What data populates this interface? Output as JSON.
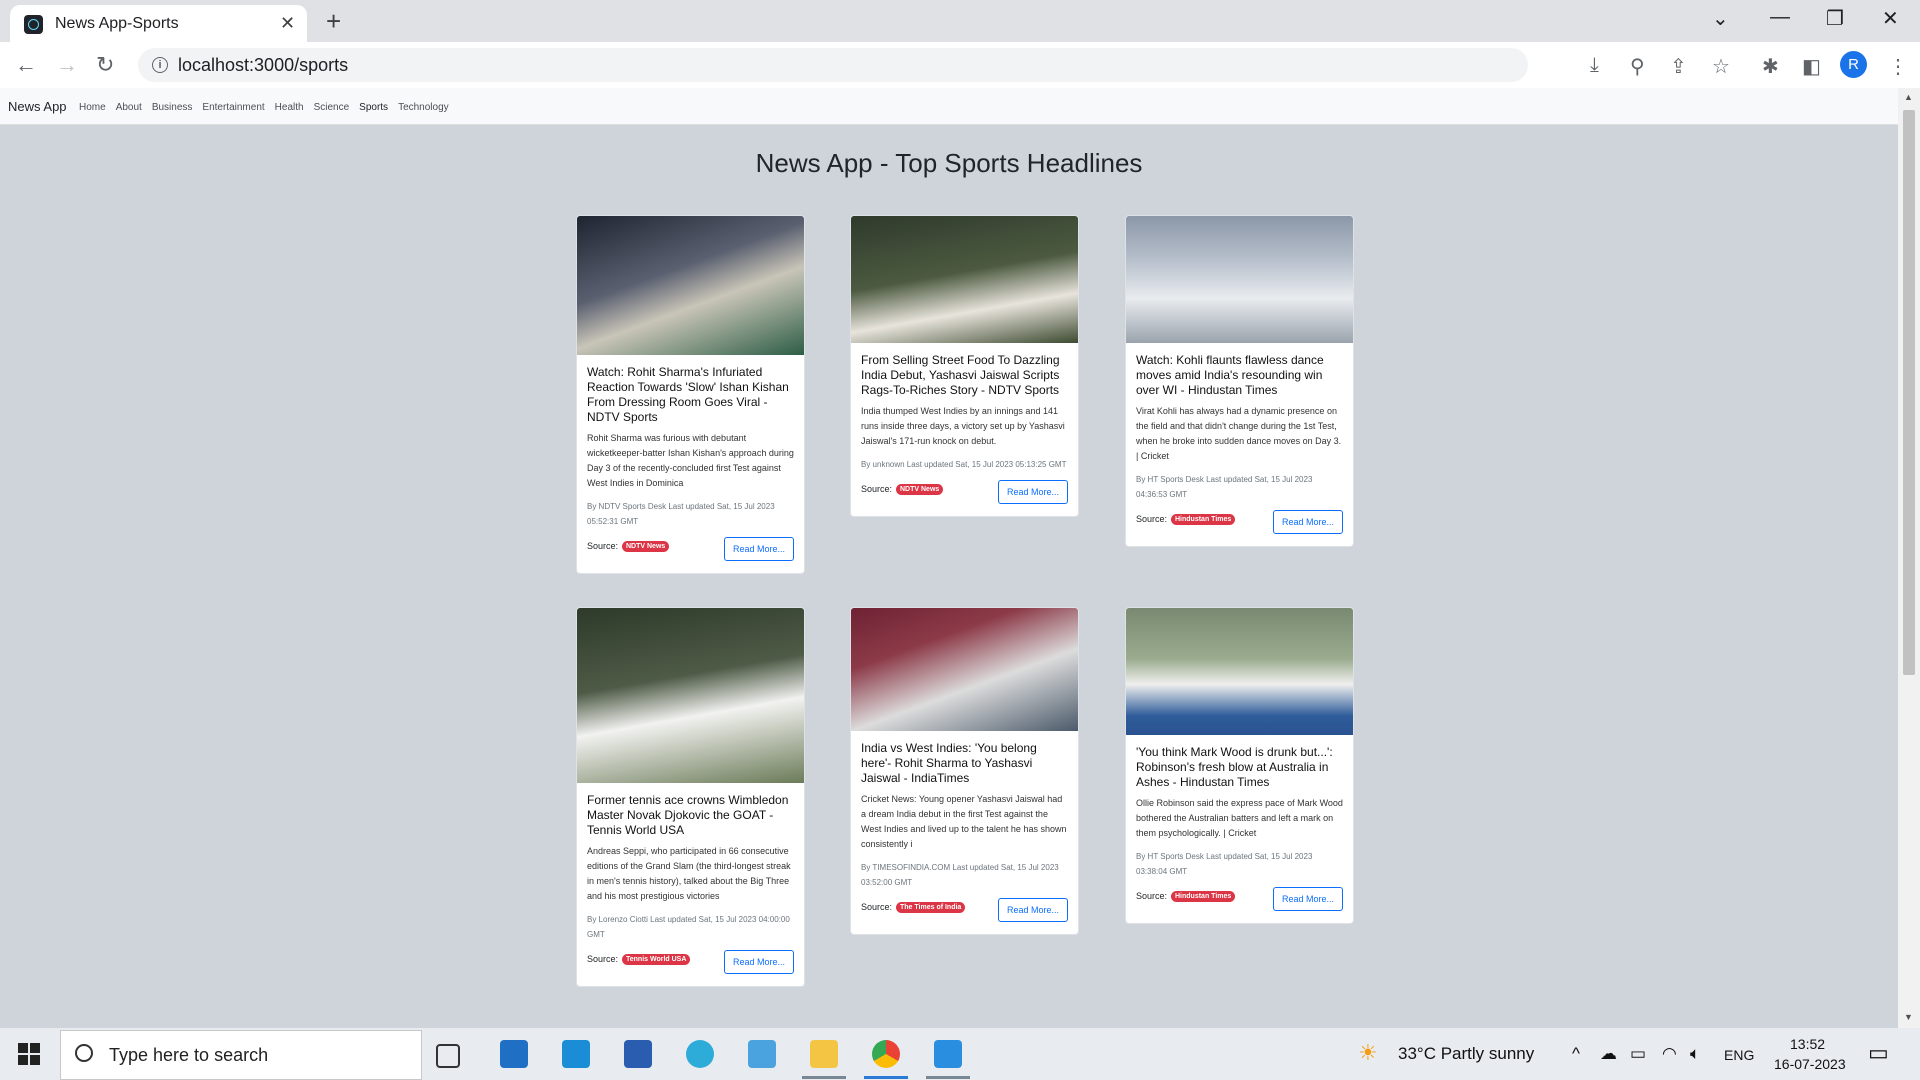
{
  "browser": {
    "tab_title": "News App-Sports",
    "url": "localhost:3000/sports",
    "profile_initial": "R"
  },
  "navbar": {
    "brand": "News App",
    "links": [
      "Home",
      "About",
      "Business",
      "Entertainment",
      "Health",
      "Science",
      "Sports",
      "Technology"
    ]
  },
  "page": {
    "title": "News App - Top Sports Headlines"
  },
  "articles": [
    {
      "title": "Watch: Rohit Sharma's Infuriated Reaction Towards 'Slow' Ishan Kishan From Dressing Room Goes Viral - NDTV Sports",
      "description": "Rohit Sharma was furious with debutant wicketkeeper-batter Ishan Kishan's approach during Day 3 of the recently-concluded first Test against West Indies in Dominica",
      "meta": "By NDTV Sports Desk Last updated Sat, 15 Jul 2023 05:52:31 GMT",
      "source": "NDTV News",
      "read_more": "Read More..."
    },
    {
      "title": "From Selling Street Food To Dazzling India Debut, Yashasvi Jaiswal Scripts Rags-To-Riches Story - NDTV Sports",
      "description": "India thumped West Indies by an innings and 141 runs inside three days, a victory set up by Yashasvi Jaiswal's 171-run knock on debut.",
      "meta": "By unknown Last updated Sat, 15 Jul 2023 05:13:25 GMT",
      "source": "NDTV News",
      "read_more": "Read More..."
    },
    {
      "title": "Watch: Kohli flaunts flawless dance moves amid India's resounding win over WI - Hindustan Times",
      "description": "Virat Kohli has always had a dynamic presence on the field and that didn't change during the 1st Test, when he broke into sudden dance moves on Day 3. | Cricket",
      "meta": "By HT Sports Desk Last updated Sat, 15 Jul 2023 04:36:53 GMT",
      "source": "Hindustan Times",
      "read_more": "Read More..."
    },
    {
      "title": "Former tennis ace crowns Wimbledon Master Novak Djokovic the GOAT - Tennis World USA",
      "description": "Andreas Seppi, who participated in 66 consecutive editions of the Grand Slam (the third-longest streak in men's tennis history), talked about the Big Three and his most prestigious victories",
      "meta": "By Lorenzo Ciotti Last updated Sat, 15 Jul 2023 04:00:00 GMT",
      "source": "Tennis World USA",
      "read_more": "Read More..."
    },
    {
      "title": "India vs West Indies: 'You belong here'- Rohit Sharma to Yashasvi Jaiswal - IndiaTimes",
      "description": "Cricket News: Young opener Yashasvi Jaiswal had a dream India debut in the first Test against the West Indies and lived up to the talent he has shown consistently i",
      "meta": "By TIMESOFINDIA.COM Last updated Sat, 15 Jul 2023 03:52:00 GMT",
      "source": "The Times of India",
      "read_more": "Read More..."
    },
    {
      "title": "'You think Mark Wood is drunk but...': Robinson's fresh blow at Australia in Ashes - Hindustan Times",
      "description": "Ollie Robinson said the express pace of Mark Wood bothered the Australian batters and left a mark on them psychologically. | Cricket",
      "meta": "By HT Sports Desk Last updated Sat, 15 Jul 2023 03:38:04 GMT",
      "source": "Hindustan Times",
      "read_more": "Read More..."
    }
  ],
  "taskbar": {
    "search_placeholder": "Type here to search",
    "weather": "33°C  Partly sunny",
    "language": "ENG",
    "time": "13:52",
    "date": "16-07-2023"
  }
}
